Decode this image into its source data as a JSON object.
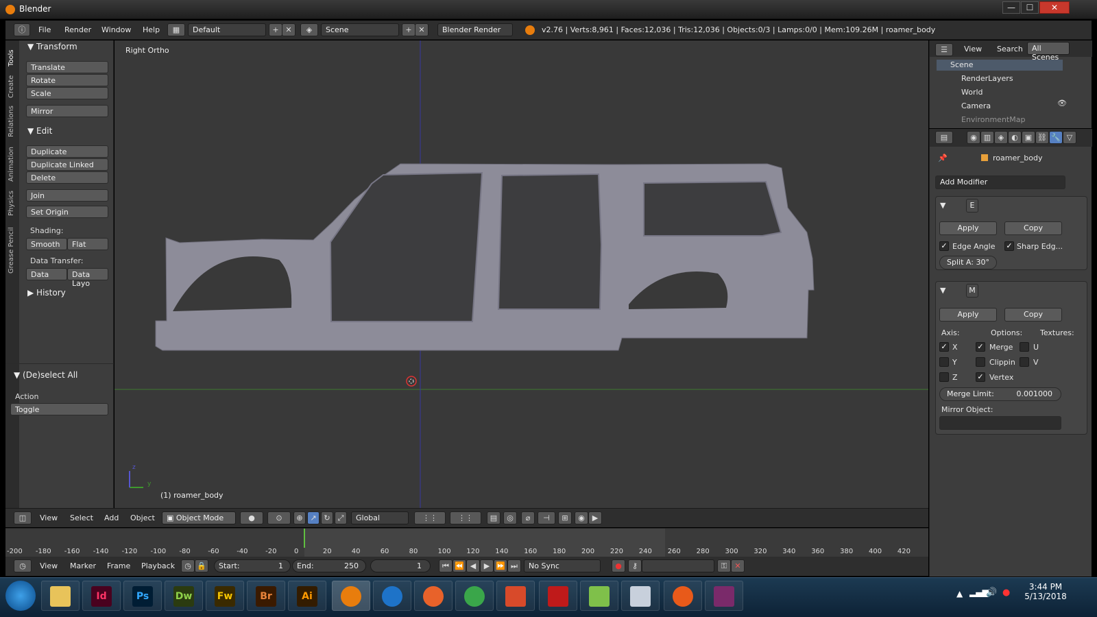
{
  "window": {
    "title": "Blender",
    "minimize": "—",
    "maximize": "☐",
    "close": "✕"
  },
  "info_header": {
    "menus": [
      "File",
      "Render",
      "Window",
      "Help"
    ],
    "screen_layout": "Default",
    "scene": "Scene",
    "render_engine": "Blender Render",
    "stats": "v2.76 | Verts:8,961 | Faces:12,036 | Tris:12,036 | Objects:0/3 | Lamps:0/0 | Mem:109.26M | roamer_body"
  },
  "tool_tabs": [
    "Tools",
    "Create",
    "Relations",
    "Animation",
    "Physics",
    "Grease Pencil"
  ],
  "tool_shelf": {
    "transform_title": "Transform",
    "transform_buttons": [
      "Translate",
      "Rotate",
      "Scale"
    ],
    "mirror": "Mirror",
    "edit_title": "Edit",
    "edit_buttons": [
      "Duplicate",
      "Duplicate Linked",
      "Delete"
    ],
    "join": "Join",
    "set_origin": "Set Origin",
    "shading_label": "Shading:",
    "smooth": "Smooth",
    "flat": "Flat",
    "data_transfer_label": "Data Transfer:",
    "data": "Data",
    "data_layout": "Data Layo",
    "history_title": "History"
  },
  "operator_panel": {
    "title": "(De)select All",
    "action_label": "Action",
    "action_value": "Toggle"
  },
  "viewport": {
    "view_name": "Right Ortho",
    "object_label": "(1) roamer_body",
    "axis_z": "z",
    "axis_y": "y"
  },
  "viewport_header": {
    "menus": [
      "View",
      "Select",
      "Add",
      "Object"
    ],
    "mode": "Object Mode",
    "orientation": "Global"
  },
  "outliner": {
    "menus": [
      "View",
      "Search"
    ],
    "filter": "All Scenes",
    "items": [
      "Scene",
      "RenderLayers",
      "World",
      "Camera",
      "EnvironmentMap"
    ]
  },
  "properties": {
    "object_name": "roamer_body",
    "add_modifier": "Add Modifier",
    "edge_split": {
      "short_name": "E",
      "apply": "Apply",
      "copy": "Copy",
      "edge_angle": "Edge Angle",
      "edge_angle_checked": true,
      "sharp_edges": "Sharp Edg...",
      "sharp_edges_checked": true,
      "split_angle": "Split A: 30°"
    },
    "mirror": {
      "short_name": "M",
      "apply": "Apply",
      "copy": "Copy",
      "axis_label": "Axis:",
      "options_label": "Options:",
      "textures_label": "Textures:",
      "axis": [
        {
          "label": "X",
          "checked": true
        },
        {
          "label": "Y",
          "checked": false
        },
        {
          "label": "Z",
          "checked": false
        }
      ],
      "options": [
        {
          "label": "Merge",
          "checked": true
        },
        {
          "label": "Clippin",
          "checked": false
        },
        {
          "label": "Vertex",
          "checked": true
        }
      ],
      "textures": [
        {
          "label": "U",
          "checked": false
        },
        {
          "label": "V",
          "checked": false
        }
      ],
      "merge_limit_label": "Merge Limit:",
      "merge_limit_value": "0.001000",
      "mirror_object_label": "Mirror Object:"
    }
  },
  "timeline": {
    "ticks": [
      "-200",
      "-180",
      "-160",
      "-140",
      "-120",
      "-100",
      "-80",
      "-60",
      "-40",
      "-20",
      "0",
      "20",
      "40",
      "60",
      "80",
      "100",
      "120",
      "140",
      "160",
      "180",
      "200",
      "220",
      "240",
      "260",
      "280",
      "300",
      "320",
      "340",
      "360",
      "380",
      "400",
      "420"
    ],
    "current_frame_marker": 0
  },
  "timeline_header": {
    "menus": [
      "View",
      "Marker",
      "Frame",
      "Playback"
    ],
    "start_label": "Start:",
    "start_value": "1",
    "end_label": "End:",
    "end_value": "250",
    "current_frame": "1",
    "sync": "No Sync"
  },
  "taskbar": {
    "apps": [
      "Id",
      "Ps",
      "Dw",
      "Fw",
      "Br",
      "Ai"
    ],
    "time": "3:44 PM",
    "date": "5/13/2018"
  },
  "colors": {
    "accent_blue": "#5680c2",
    "orange": "#e87d0d",
    "grid_green": "#3f7a2e",
    "axis_blue": "#3636a0"
  }
}
